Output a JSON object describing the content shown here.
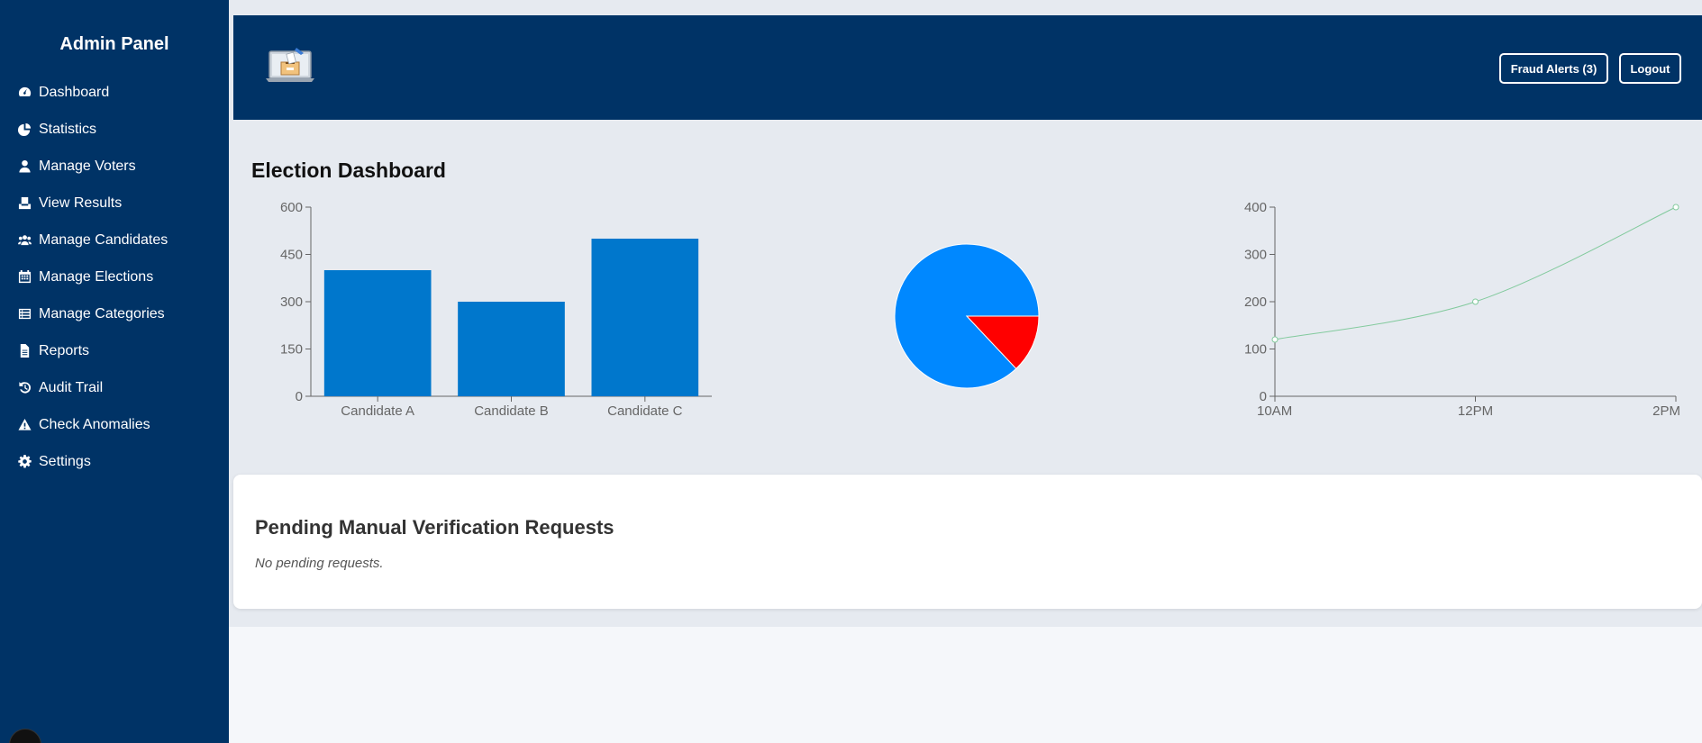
{
  "sidebar": {
    "title": "Admin Panel",
    "items": [
      {
        "label": "Dashboard",
        "icon": "tachometer-icon"
      },
      {
        "label": "Statistics",
        "icon": "pie-chart-icon"
      },
      {
        "label": "Manage Voters",
        "icon": "user-icon"
      },
      {
        "label": "View Results",
        "icon": "vote-box-icon"
      },
      {
        "label": "Manage Candidates",
        "icon": "users-icon"
      },
      {
        "label": "Manage Elections",
        "icon": "calendar-icon"
      },
      {
        "label": "Manage Categories",
        "icon": "list-icon"
      },
      {
        "label": "Reports",
        "icon": "file-icon"
      },
      {
        "label": "Audit Trail",
        "icon": "history-icon"
      },
      {
        "label": "Check Anomalies",
        "icon": "warning-icon"
      },
      {
        "label": "Settings",
        "icon": "gear-icon"
      }
    ]
  },
  "header": {
    "logo_icon": "ballot-laptop-icon",
    "fraud_alerts_label": "Fraud Alerts (3)",
    "logout_label": "Logout",
    "background": "#003366"
  },
  "main": {
    "title": "Election Dashboard"
  },
  "chart_data": [
    {
      "type": "bar",
      "categories": [
        "Candidate A",
        "Candidate B",
        "Candidate C"
      ],
      "values": [
        400,
        300,
        500
      ],
      "ylim": [
        0,
        600
      ],
      "yticks": [
        0,
        150,
        300,
        450,
        600
      ],
      "color": "#0077cc"
    },
    {
      "type": "pie",
      "values": [
        87,
        13
      ],
      "colors": [
        "#0088ff",
        "#ff0000"
      ]
    },
    {
      "type": "line",
      "x": [
        "10AM",
        "12PM",
        "2PM"
      ],
      "values": [
        120,
        200,
        400
      ],
      "ylim": [
        0,
        400
      ],
      "yticks": [
        0,
        100,
        200,
        300,
        400
      ],
      "color": "#82ca9d"
    }
  ],
  "verification": {
    "title": "Pending Manual Verification Requests",
    "empty_text": "No pending requests."
  }
}
